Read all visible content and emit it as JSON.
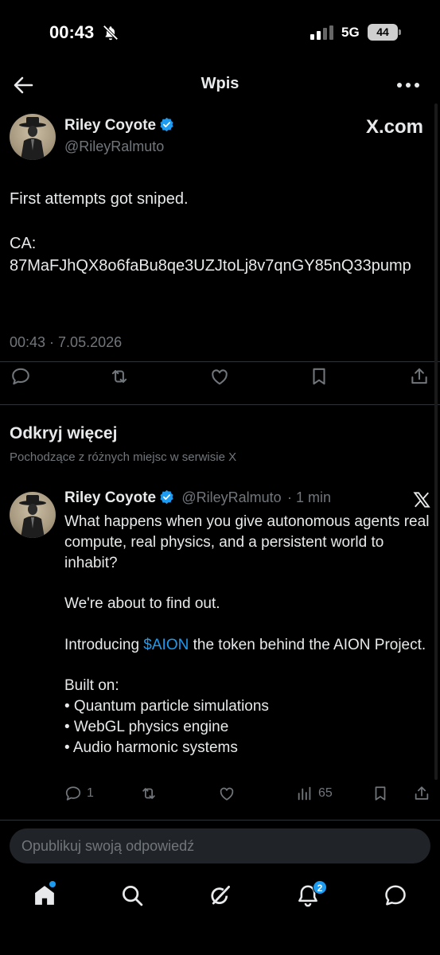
{
  "status_bar": {
    "time": "00:43",
    "network": "5G",
    "battery": "44"
  },
  "header": {
    "title": "Wpis"
  },
  "tweet": {
    "author_name": "Riley Coyote",
    "author_handle": "@RileyRalmuto",
    "source": "X.com",
    "text": "First attempts got sniped.\n\nCA:\n87MaFJhQX8o6faBu8qe3UZJtoLj8v7qnGY85nQ33pump",
    "timestamp": "00:43 · 7.05.2026"
  },
  "discover": {
    "title": "Odkryj więcej",
    "subtitle": "Pochodzące z różnych miejsc w serwisie X"
  },
  "related_tweet": {
    "author_name": "Riley Coyote",
    "author_handle": "@RileyRalmuto",
    "time": "· 1 min",
    "paragraph_1": "What happens when you give autonomous agents real compute, real physics, and a persistent world to inhabit?",
    "paragraph_2": "We're about to find out.",
    "intro_before": "Introducing ",
    "cashtag": "$AION",
    "intro_after": " the token behind the AION Project.",
    "built_on": "Built on:",
    "bullets": [
      "• Quantum particle simulations",
      "• WebGL physics engine",
      "• Audio harmonic systems"
    ],
    "reply_count": "1",
    "view_count": "65"
  },
  "reply": {
    "placeholder": "Opublikuj swoją odpowiedź"
  },
  "nav": {
    "notifications_badge": "2"
  },
  "colors": {
    "accent": "#1d9bf0",
    "background": "#000000",
    "secondary_text": "#71767b",
    "divider": "#2f3336"
  }
}
